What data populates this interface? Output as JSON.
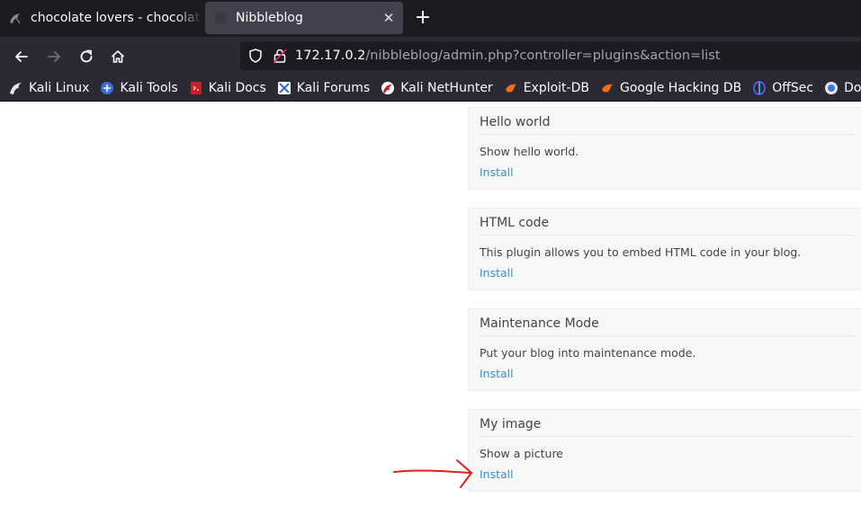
{
  "tabs": [
    {
      "title": "chocolate lovers - chocolate lovers",
      "favicon": "kali-dragon-icon",
      "active": false
    },
    {
      "title": "Nibbleblog",
      "favicon": "blank-page-icon",
      "active": true
    }
  ],
  "new_tab_label": "+",
  "close_glyph": "✕",
  "url": {
    "host": "172.17.0.2",
    "path": "/nibbleblog/admin.php?controller=plugins&action=list"
  },
  "bookmarks": [
    {
      "label": "Kali Linux",
      "icon": "kali-dragon-icon"
    },
    {
      "label": "Kali Tools",
      "icon": "kali-tools-icon"
    },
    {
      "label": "Kali Docs",
      "icon": "kali-docs-icon"
    },
    {
      "label": "Kali Forums",
      "icon": "kali-forums-icon"
    },
    {
      "label": "Kali NetHunter",
      "icon": "nethunter-icon"
    },
    {
      "label": "Exploit-DB",
      "icon": "exploit-db-icon"
    },
    {
      "label": "Google Hacking DB",
      "icon": "ghdb-icon"
    },
    {
      "label": "OffSec",
      "icon": "offsec-icon"
    },
    {
      "label": "Dockerlabs",
      "icon": "dockerlabs-icon"
    }
  ],
  "plugins": [
    {
      "name": "Hello world",
      "description": "Show hello world.",
      "action": "Install"
    },
    {
      "name": "HTML code",
      "description": "This plugin allows you to embed HTML code in your blog.",
      "action": "Install"
    },
    {
      "name": "Maintenance Mode",
      "description": "Put your blog into maintenance mode.",
      "action": "Install"
    },
    {
      "name": "My image",
      "description": "Show a picture",
      "action": "Install"
    }
  ],
  "colors": {
    "tabstrip": "#1c1b22",
    "toolbar": "#2b2a33",
    "link": "#3a8fce",
    "annotation_arrow": "#e0201b"
  }
}
